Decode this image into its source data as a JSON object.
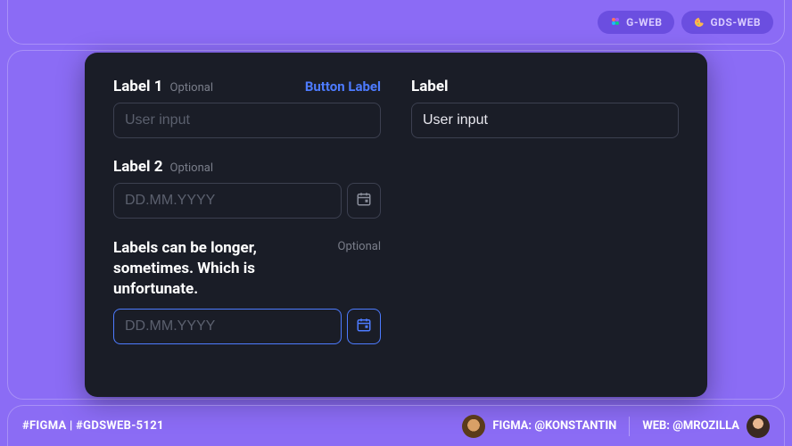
{
  "header": {
    "pills": [
      {
        "label": "G-WEB",
        "icon": "figma-color-icon"
      },
      {
        "label": "GDS-WEB",
        "icon": "palette-icon"
      }
    ]
  },
  "form": {
    "left": [
      {
        "label": "Label 1",
        "optional": "Optional",
        "action": "Button Label",
        "placeholder": "User input",
        "value": "",
        "type": "text"
      },
      {
        "label": "Label 2",
        "optional": "Optional",
        "action": "",
        "placeholder": "DD.MM.YYYY",
        "value": "",
        "type": "date"
      },
      {
        "label": "Labels can be longer, sometimes. Which is unfortunate.",
        "optional": "Optional",
        "action": "",
        "placeholder": "DD.MM.YYYY",
        "value": "",
        "type": "date",
        "active": true
      }
    ],
    "right": [
      {
        "label": "Label",
        "optional": "",
        "action": "",
        "placeholder": "",
        "value": "User input",
        "type": "text"
      }
    ]
  },
  "footer": {
    "tag": "#FIGMA | #GDSWEB-5121",
    "credits": {
      "figma": {
        "prefix": "FIGMA: ",
        "handle": "@KONSTANTIN"
      },
      "web": {
        "prefix": "WEB: ",
        "handle": "@MROZILLA"
      }
    }
  }
}
